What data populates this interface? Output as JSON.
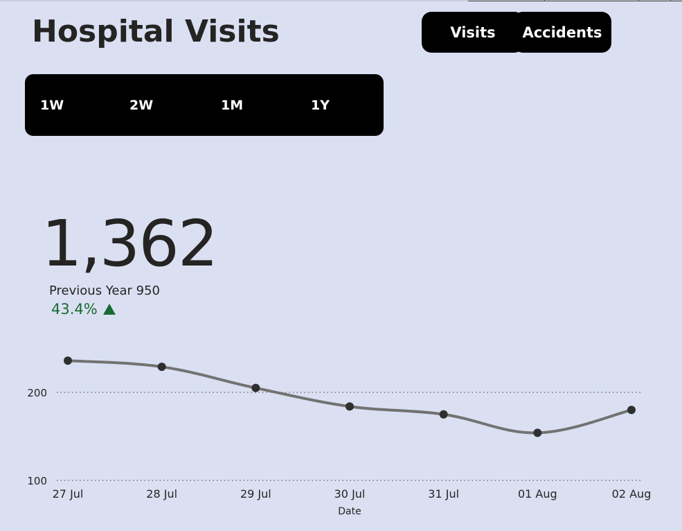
{
  "header": {
    "title": "Hospital Visits"
  },
  "metric_toggle": {
    "options": [
      "Visits",
      "Accidents"
    ]
  },
  "range_selector": {
    "options": [
      "1W",
      "2W",
      "1M",
      "1Y"
    ]
  },
  "kpi": {
    "value": "1,362",
    "previous_label": "Previous Year 950",
    "change": "43.4%",
    "trend": "up",
    "trend_color": "#1a6b32"
  },
  "chart_data": {
    "type": "line",
    "categories": [
      "27 Jul",
      "28 Jul",
      "29 Jul",
      "30 Jul",
      "31 Jul",
      "01 Aug",
      "02 Aug"
    ],
    "values": [
      236,
      229,
      205,
      184,
      175,
      154,
      180
    ],
    "xlabel": "Date",
    "ylabel": "",
    "yticks": [
      100,
      200
    ],
    "ylim": [
      100,
      280
    ],
    "grid": "dotted horizontal",
    "line_color": "#727272",
    "marker_color": "#2f2f2f"
  }
}
